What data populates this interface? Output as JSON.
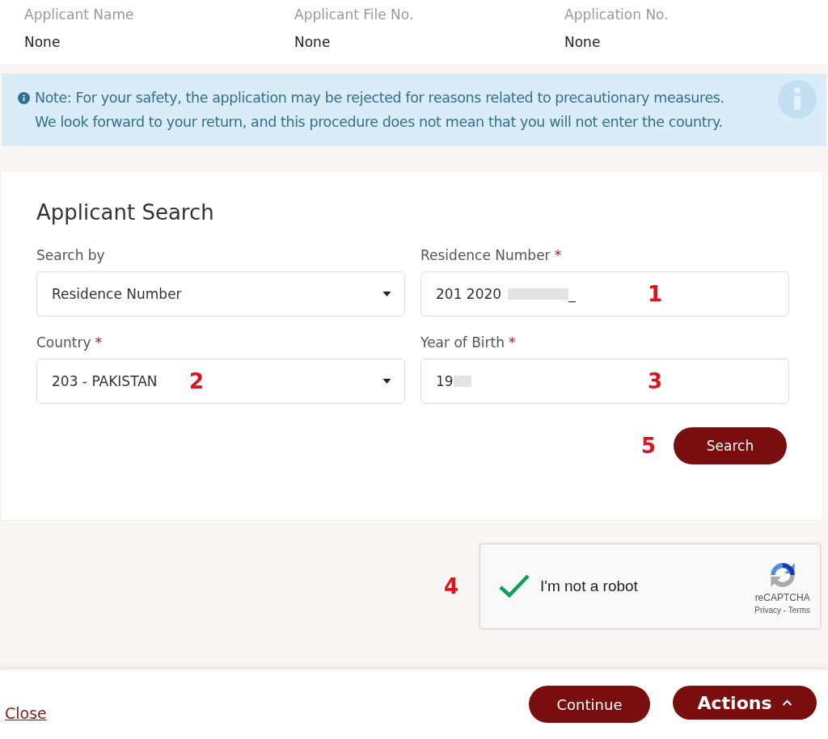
{
  "summary": [
    {
      "label": "Applicant Name",
      "value": "None"
    },
    {
      "label": "Applicant File No.",
      "value": "None"
    },
    {
      "label": "Application No.",
      "value": "None"
    }
  ],
  "note": {
    "lines": [
      "Note: For your safety, the application may be rejected for reasons related to precautionary measures.",
      "We look forward to your return, and this procedure does not mean that you will not enter the country."
    ]
  },
  "search_card": {
    "title": "Applicant Search",
    "fields": [
      {
        "kind": "select",
        "label": "Search by",
        "value": "Residence Number",
        "redacted": false
      },
      {
        "kind": "input",
        "label": "Residence Number",
        "required_mark": "*",
        "value": "201 2020",
        "redacted": true,
        "suffix": "_",
        "annotation": "1"
      },
      {
        "kind": "select",
        "label": "Country",
        "required_mark": "*",
        "value": "203 - PAKISTAN",
        "redacted": false,
        "annotation": "2"
      },
      {
        "kind": "input",
        "label": "Year of Birth",
        "required_mark": "*",
        "value": "19",
        "redacted": true,
        "annotation": "3"
      }
    ],
    "button": {
      "label": "Search",
      "annotation": "5"
    }
  },
  "captcha": {
    "checked": true,
    "label": "I'm not a robot",
    "brand": "reCAPTCHA",
    "links": "Privacy - Terms",
    "annotation": "4"
  },
  "footer": {
    "close": "Close",
    "continue": "Continue",
    "actions": "Actions"
  }
}
